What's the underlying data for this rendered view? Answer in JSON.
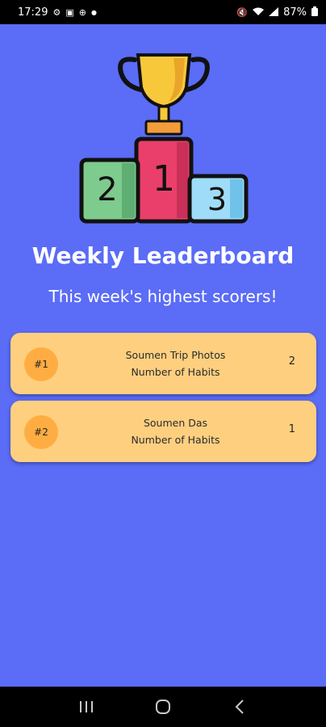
{
  "status_bar": {
    "time": "17:29",
    "battery": "87%"
  },
  "header": {
    "title": "Weekly Leaderboard",
    "subtitle": "This week's highest scorers!"
  },
  "podium": {
    "second": "2",
    "first": "1",
    "third": "3"
  },
  "leaderboard": [
    {
      "rank": "#1",
      "name": "Soumen Trip Photos",
      "label": "Number of Habits",
      "score": "2"
    },
    {
      "rank": "#2",
      "name": "Soumen Das",
      "label": "Number of Habits",
      "score": "1"
    }
  ],
  "colors": {
    "background": "#5b6cf6",
    "card": "#ffcf80",
    "badge": "#ffad42"
  }
}
